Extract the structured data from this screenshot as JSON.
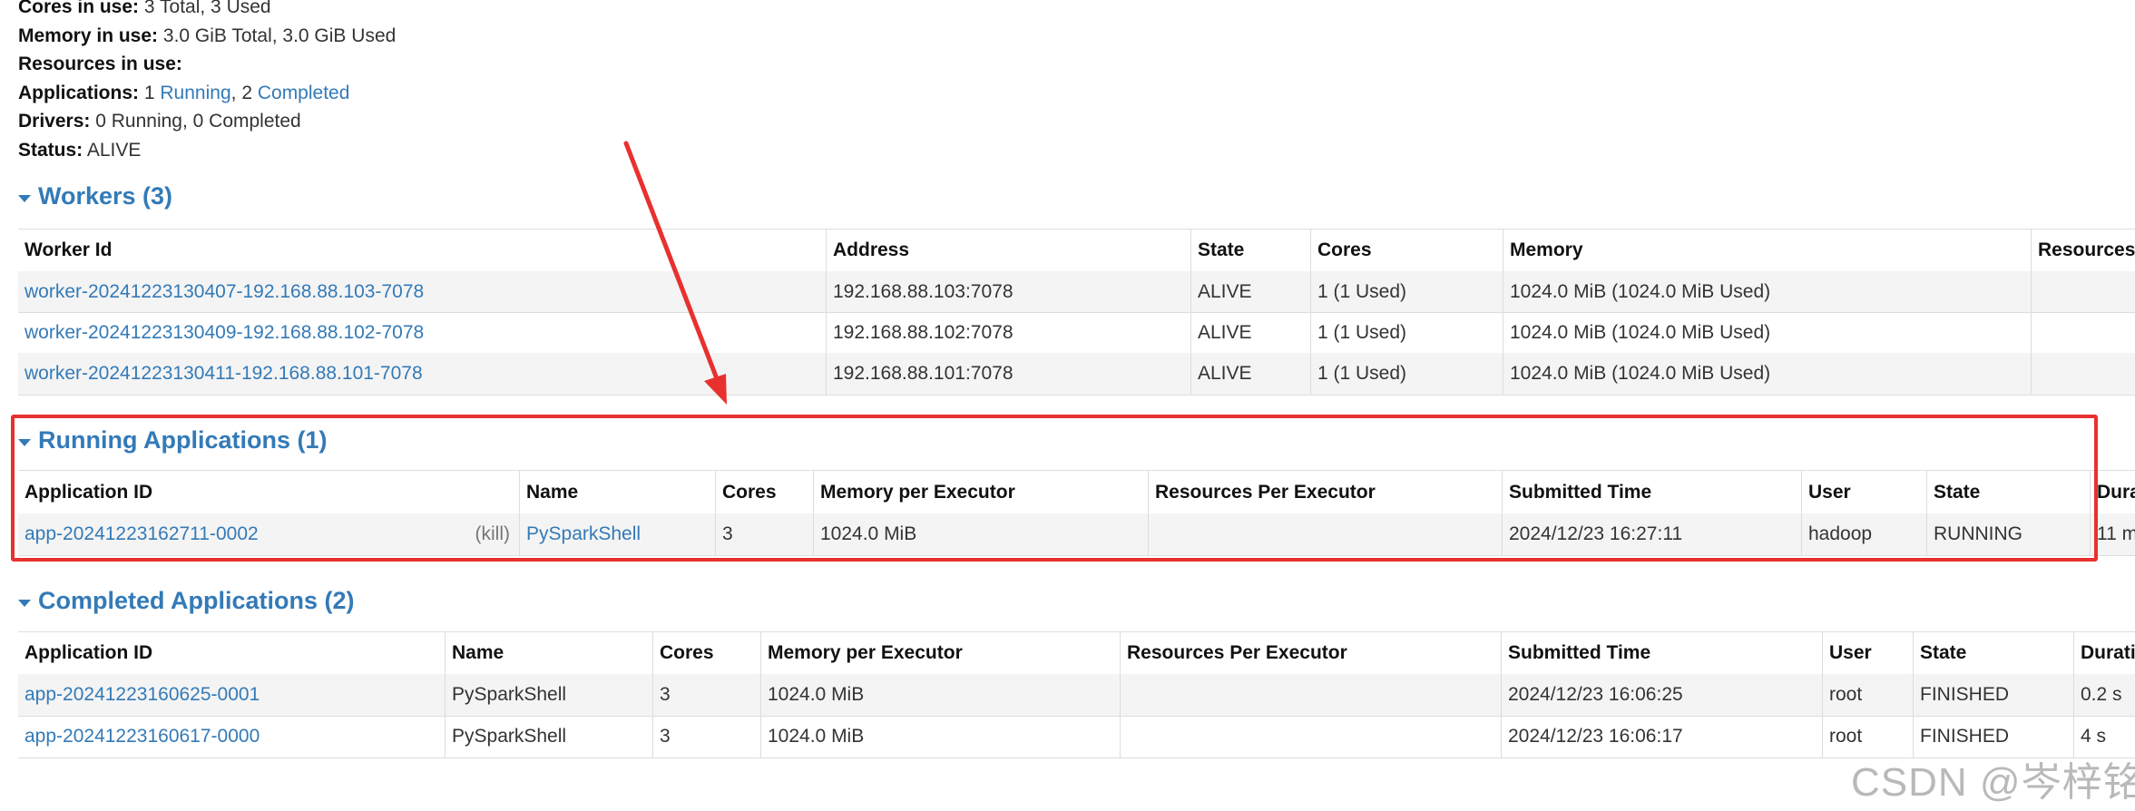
{
  "summary": {
    "cores_label": "Cores in use:",
    "cores_value": "3 Total, 3 Used",
    "memory_label": "Memory in use:",
    "memory_value": "3.0 GiB Total, 3.0 GiB Used",
    "resources_label": "Resources in use:",
    "applications_label": "Applications:",
    "applications_running_count": "1",
    "applications_running_link": "Running",
    "applications_sep": ",",
    "applications_completed_count": "2",
    "applications_completed_link": "Completed",
    "drivers_label": "Drivers:",
    "drivers_value": "0 Running, 0 Completed",
    "status_label": "Status:",
    "status_value": "ALIVE"
  },
  "workers": {
    "title": "Workers (3)",
    "columns": [
      "Worker Id",
      "Address",
      "State",
      "Cores",
      "Memory",
      "Resources"
    ],
    "rows": [
      {
        "id": "worker-20241223130407-192.168.88.103-7078",
        "address": "192.168.88.103:7078",
        "state": "ALIVE",
        "cores": "1 (1 Used)",
        "memory": "1024.0 MiB (1024.0 MiB Used)",
        "resources": ""
      },
      {
        "id": "worker-20241223130409-192.168.88.102-7078",
        "address": "192.168.88.102:7078",
        "state": "ALIVE",
        "cores": "1 (1 Used)",
        "memory": "1024.0 MiB (1024.0 MiB Used)",
        "resources": ""
      },
      {
        "id": "worker-20241223130411-192.168.88.101-7078",
        "address": "192.168.88.101:7078",
        "state": "ALIVE",
        "cores": "1 (1 Used)",
        "memory": "1024.0 MiB (1024.0 MiB Used)",
        "resources": ""
      }
    ]
  },
  "running": {
    "title": "Running Applications (1)",
    "columns": [
      "Application ID",
      "Name",
      "Cores",
      "Memory per Executor",
      "Resources Per Executor",
      "Submitted Time",
      "User",
      "State",
      "Dura"
    ],
    "rows": [
      {
        "id": "app-20241223162711-0002",
        "kill": "(kill)",
        "name": "PySparkShell",
        "cores": "3",
        "memory": "1024.0 MiB",
        "resources": "",
        "submitted": "2024/12/23 16:27:11",
        "user": "hadoop",
        "state": "RUNNING",
        "duration": "11 m"
      }
    ]
  },
  "completed": {
    "title": "Completed Applications (2)",
    "columns": [
      "Application ID",
      "Name",
      "Cores",
      "Memory per Executor",
      "Resources Per Executor",
      "Submitted Time",
      "User",
      "State",
      "Durati"
    ],
    "rows": [
      {
        "id": "app-20241223160625-0001",
        "name": "PySparkShell",
        "cores": "3",
        "memory": "1024.0 MiB",
        "resources": "",
        "submitted": "2024/12/23 16:06:25",
        "user": "root",
        "state": "FINISHED",
        "duration": "0.2 s"
      },
      {
        "id": "app-20241223160617-0000",
        "name": "PySparkShell",
        "cores": "3",
        "memory": "1024.0 MiB",
        "resources": "",
        "submitted": "2024/12/23 16:06:17",
        "user": "root",
        "state": "FINISHED",
        "duration": "4 s"
      }
    ]
  },
  "watermark": "CSDN @岑梓铭",
  "colors": {
    "link": "#337ab7",
    "annotation": "#e8312f",
    "row_stripe": "#f4f4f4"
  }
}
